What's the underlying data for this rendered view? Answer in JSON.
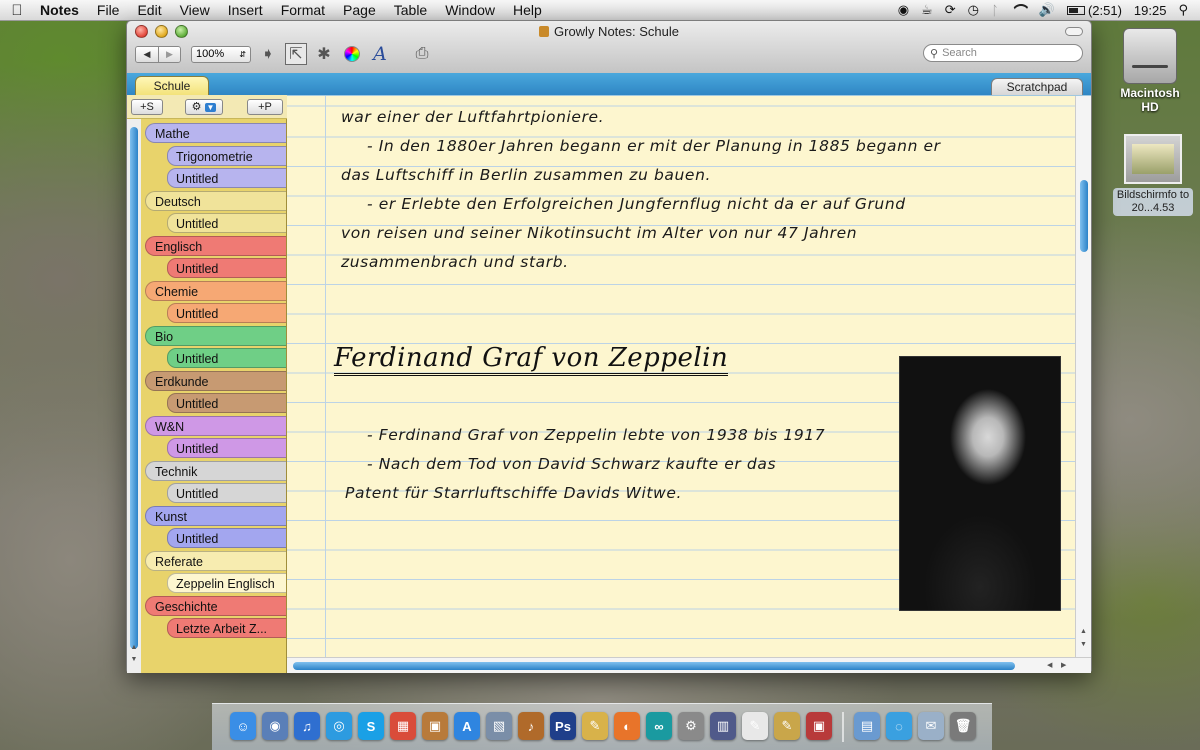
{
  "menubar": {
    "app": "Notes",
    "items": [
      "File",
      "Edit",
      "View",
      "Insert",
      "Format",
      "Page",
      "Table",
      "Window",
      "Help"
    ],
    "battery": "(2:51)",
    "clock": "19:25"
  },
  "window": {
    "title": "Growly Notes: Schule",
    "zoom": "100%",
    "search_placeholder": "Search",
    "notebook_tab": "Schule",
    "scratchpad_tab": "Scratchpad"
  },
  "sidebar": {
    "add_section": "+S",
    "add_page": "+P",
    "sections": [
      {
        "name": "Mathe",
        "color": "#b7b4ee",
        "pages": [
          "Trigonometrie",
          "Untitled"
        ]
      },
      {
        "name": "Deutsch",
        "color": "#f0e39a",
        "pages": [
          "Untitled"
        ]
      },
      {
        "name": "Englisch",
        "color": "#ef7a74",
        "pages": [
          "Untitled"
        ]
      },
      {
        "name": "Chemie",
        "color": "#f6a874",
        "pages": [
          "Untitled"
        ]
      },
      {
        "name": "Bio",
        "color": "#6fcf86",
        "pages": [
          "Untitled"
        ]
      },
      {
        "name": "Erdkunde",
        "color": "#c79a72",
        "pages": [
          "Untitled"
        ]
      },
      {
        "name": "W&N",
        "color": "#cf98e6",
        "pages": [
          "Untitled"
        ]
      },
      {
        "name": "Technik",
        "color": "#d6d6d6",
        "pages": [
          "Untitled"
        ]
      },
      {
        "name": "Kunst",
        "color": "#a3a6ef",
        "pages": [
          "Untitled"
        ]
      },
      {
        "name": "Referate",
        "color": "#f7ecb0",
        "pages": [
          "Zeppelin Englisch"
        ]
      },
      {
        "name": "Geschichte",
        "color": "#ef7a74",
        "pages": [
          "Letzte Arbeit Z..."
        ]
      }
    ]
  },
  "note": {
    "para1": [
      "war einer der Luftfahrtpioniere.",
      "-   In den 1880er Jahren begann er mit der Planung in 1885 begann er",
      "das Luftschiff in Berlin zusammen zu bauen.",
      "-   er Erlebte den Erfolgreichen Jungfernflug nicht da er auf Grund",
      "von reisen und seiner Nikotinsucht im Alter von nur 47 Jahren",
      "zusammenbrach und starb."
    ],
    "heading": "Ferdinand Graf von Zeppelin",
    "para2": [
      "-   Ferdinand Graf von Zeppelin lebte von 1938 bis 1917",
      "-   Nach dem Tod von David Schwarz kaufte er das",
      "Patent für Starrluftschiffe Davids Witwe."
    ]
  },
  "desktop": {
    "drive_label": "Macintosh HD",
    "screenshot_label": "Bildschirmfo to 20...4.53"
  },
  "dock": {
    "icons": [
      "finder-icon",
      "preview-icon",
      "itunes-icon",
      "safari-icon",
      "skype-icon",
      "ical-icon",
      "package-icon",
      "appstore-icon",
      "iphoto-icon",
      "guitar-icon",
      "photoshop-icon",
      "notes-app-icon",
      "firefox-icon",
      "arduino-icon",
      "system-prefs-icon",
      "bridge-icon",
      "textedit-icon",
      "growly-icon",
      "photo-booth-icon",
      "applications-folder-icon",
      "messages-icon",
      "mail-icon",
      "trash-icon"
    ]
  }
}
